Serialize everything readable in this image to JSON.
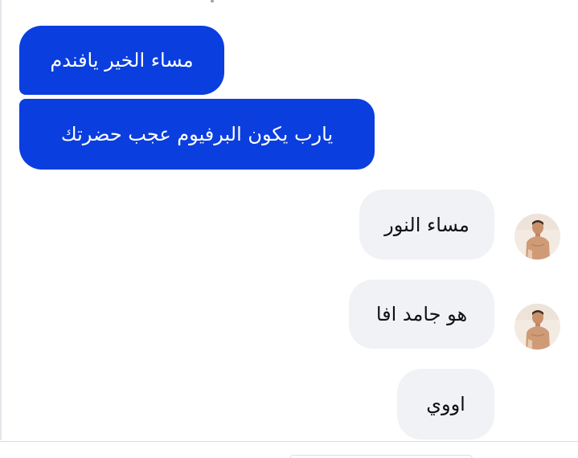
{
  "conversation": {
    "messages": [
      {
        "direction": "sent",
        "text": "مساء الخير يافندم"
      },
      {
        "direction": "sent",
        "text": "يارب يكون البرفيوم عجب حضرتك"
      },
      {
        "direction": "received",
        "text": "مساء النور",
        "avatar": "contact-avatar"
      },
      {
        "direction": "received",
        "text": "هو جامد افا",
        "avatar": "contact-avatar"
      },
      {
        "direction": "received",
        "text": "اووي"
      }
    ]
  },
  "colors": {
    "sent_bubble": "#0a3ede",
    "received_bubble": "#f0f2f5",
    "background": "#ffffff"
  }
}
